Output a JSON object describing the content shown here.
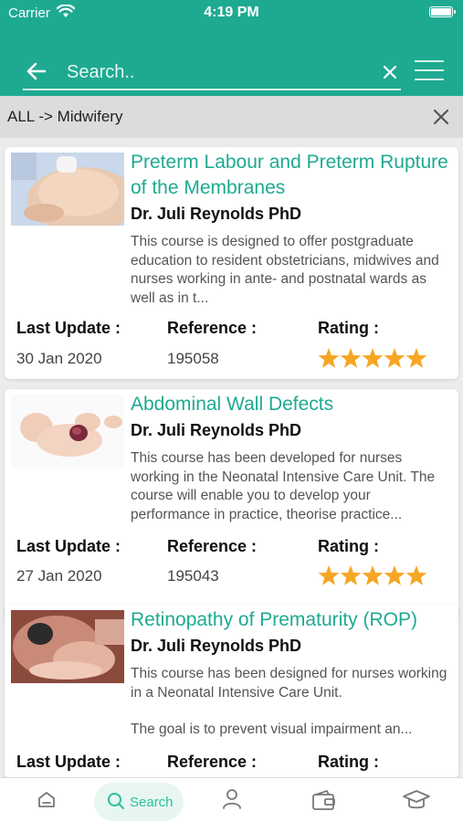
{
  "status_bar": {
    "carrier": "Carrier",
    "time": "4:19 PM"
  },
  "search": {
    "placeholder": "Search.."
  },
  "filter": {
    "breadcrumb": "ALL -> Midwifery"
  },
  "labels": {
    "last_update": "Last Update :",
    "reference": "Reference :",
    "rating": "Rating :"
  },
  "courses": [
    {
      "title": "Preterm Labour and Preterm Rupture of the Membranes",
      "author": "Dr. Juli Reynolds PhD",
      "description": "This course is designed to offer postgraduate education to resident obstetricians, midwives and nurses working in ante- and postnatal wards as well as in t...",
      "last_update": "30 Jan 2020",
      "reference": "195058",
      "rating": 5
    },
    {
      "title": "Abdominal Wall Defects",
      "author": "Dr. Juli Reynolds PhD",
      "description": "This course has been developed for nurses working in the Neonatal Intensive Care Unit. The course will enable you to develop your performance in practice, theorise practice...",
      "last_update": "27 Jan 2020",
      "reference": "195043",
      "rating": 5
    },
    {
      "title": "Retinopathy of Prematurity (ROP)",
      "author": "Dr. Juli Reynolds PhD",
      "description_line1": "This course has been designed for nurses working in a Neonatal Intensive Care Unit.",
      "description_line2": "The goal is to prevent visual impairment an..."
    }
  ],
  "tabbar": {
    "active_label": "Search"
  },
  "colors": {
    "primary": "#1eaa91",
    "star": "#f6a623",
    "tab_active": "#2bbfa0"
  },
  "icons": [
    "wifi-icon",
    "battery-icon",
    "back-arrow-icon",
    "clear-icon",
    "menu-icon",
    "close-icon",
    "star-icon",
    "home-icon",
    "search-icon",
    "profile-icon",
    "wallet-icon",
    "graduation-cap-icon"
  ]
}
